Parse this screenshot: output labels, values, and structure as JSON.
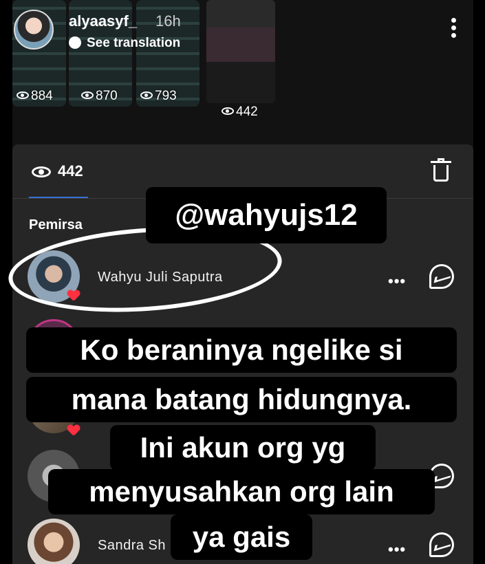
{
  "story_header": {
    "username": "alyaasyf_",
    "time": "16h",
    "translation_label": "See translation",
    "thumbnail_views": [
      "884",
      "870",
      "793",
      "442"
    ]
  },
  "viewers_panel": {
    "view_count": "442",
    "section_label": "Pemirsa",
    "viewers": [
      {
        "name": "Wahyu Juli Saputra",
        "liked": true
      },
      {
        "name": "",
        "liked": false
      },
      {
        "name": "",
        "liked": true
      },
      {
        "name": "",
        "liked": false
      },
      {
        "name": "Sandra Sh",
        "liked": false
      }
    ]
  },
  "overlay": {
    "handle_sticker": "@wahyujs12",
    "caption_lines": [
      "Ko beraninya ngelike si",
      "mana batang hidungnya.",
      "Ini akun org yg",
      "menyusahkan org lain",
      "ya gais"
    ]
  },
  "colors": {
    "sheet_background": "#262626",
    "tab_underline": "#3a6fd8",
    "like_heart": "#ff3040"
  }
}
